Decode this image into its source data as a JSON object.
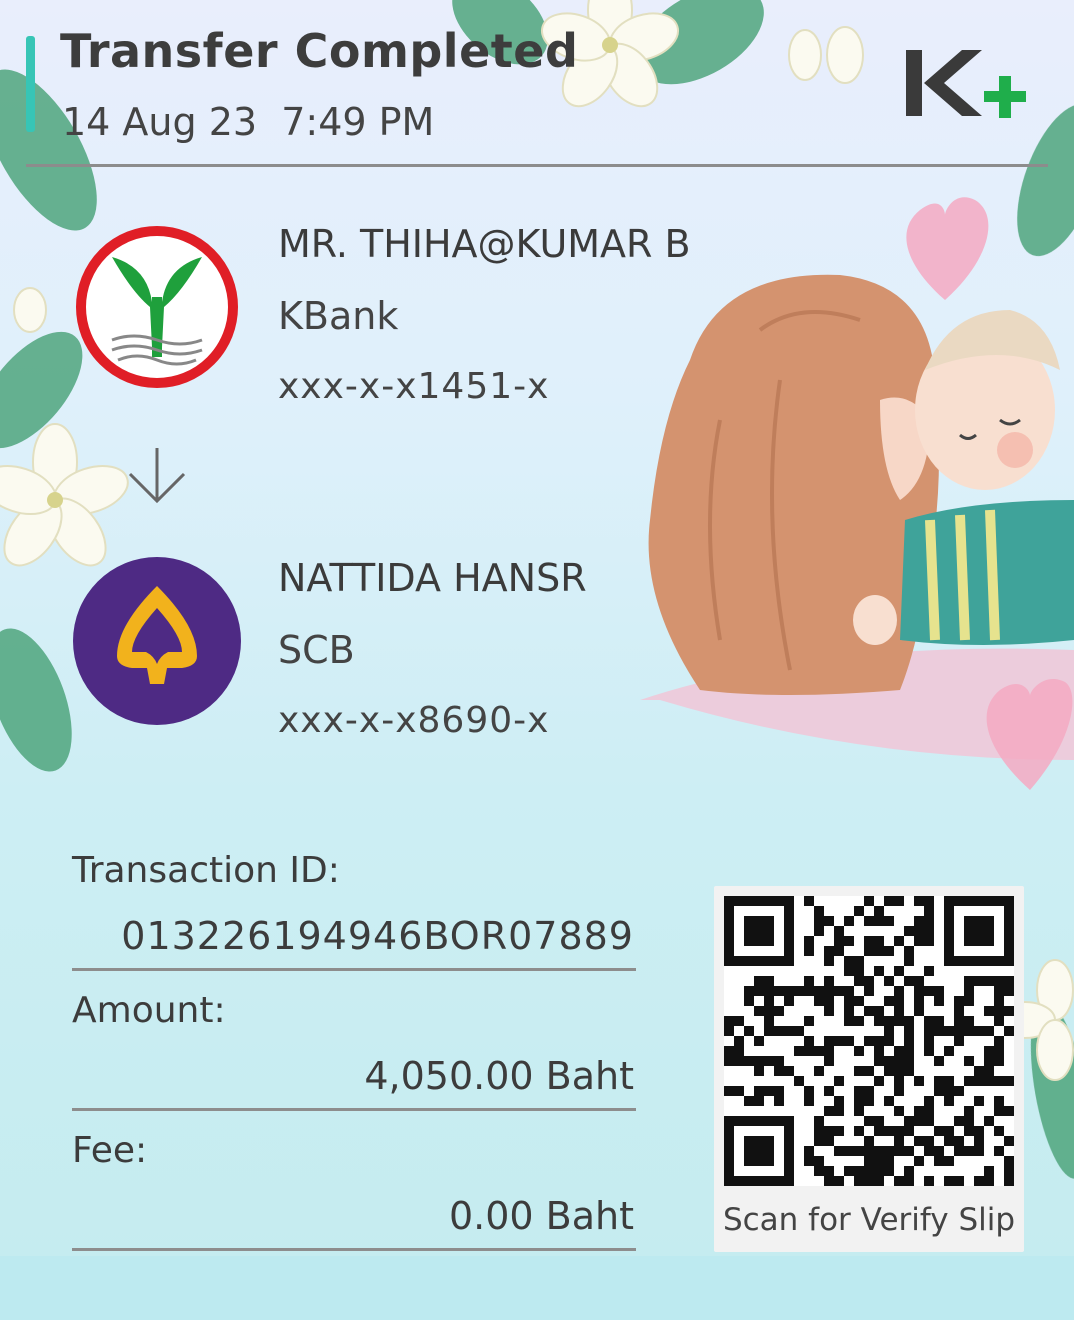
{
  "header": {
    "title": "Transfer Completed",
    "date": "14 Aug 23",
    "time": "7:49 PM",
    "datetime": "14 Aug 23  7:49 PM",
    "app_logo": "K+"
  },
  "sender": {
    "name": "MR. THIHA@KUMAR B",
    "bank": "KBank",
    "account": "xxx-x-x1451-x",
    "logo_icon": "kbank-logo-icon"
  },
  "arrow_icon": "arrow-down-icon",
  "receiver": {
    "name": "NATTIDA HANSR",
    "bank": "SCB",
    "account": "xxx-x-x8690-x",
    "logo_icon": "scb-logo-icon"
  },
  "details": {
    "transaction_id_label": "Transaction ID:",
    "transaction_id": "013226194946BOR07889",
    "amount_label": "Amount:",
    "amount": "4,050.00 Baht",
    "fee_label": "Fee:",
    "fee": "0.00 Baht"
  },
  "qr": {
    "caption": "Scan for Verify Slip"
  },
  "colors": {
    "accent": "#37c5b6",
    "kbank_green": "#1fa03c",
    "kbank_red": "#e01e26",
    "scb_purple": "#4e2a84",
    "scb_gold": "#f2b21c"
  }
}
